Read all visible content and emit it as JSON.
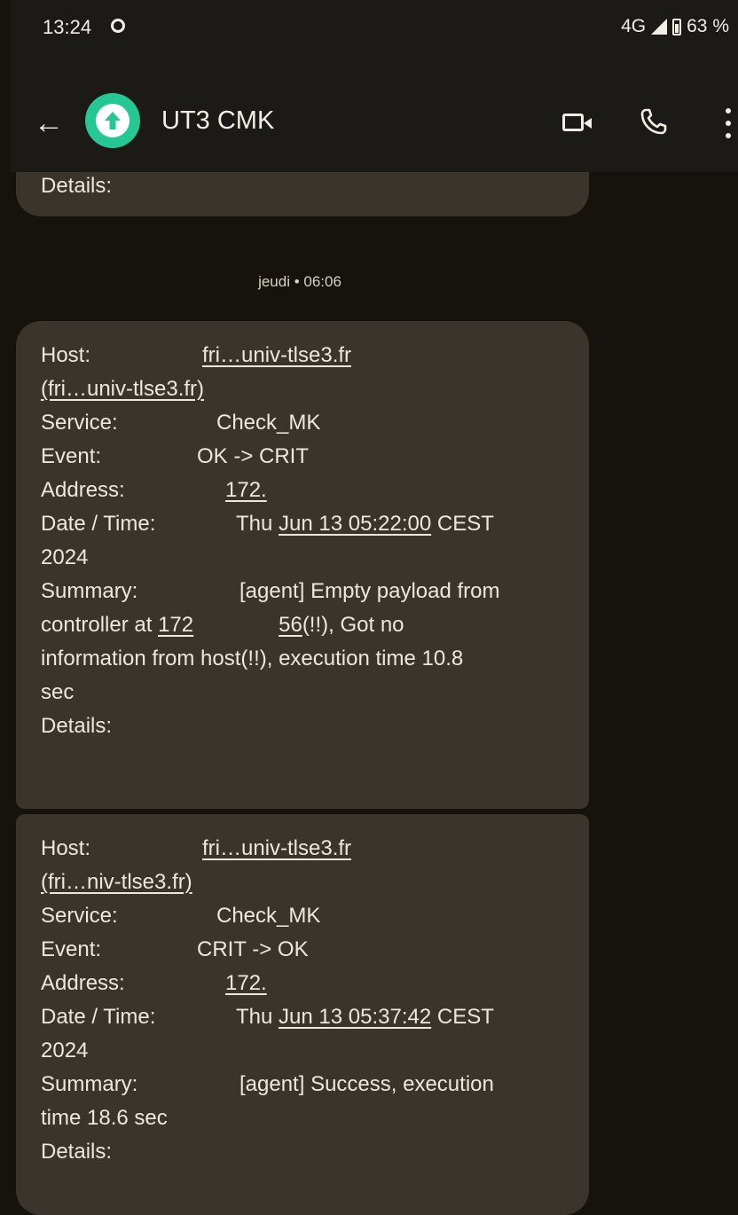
{
  "status_bar": {
    "time": "13:24",
    "network": "4G",
    "battery": "63 %"
  },
  "app_bar": {
    "contact_name": "UT3 CMK",
    "avatar_color": "#25c795"
  },
  "previous_message_tail": "Details:",
  "timestamp": "jeudi • 06:06",
  "messages": [
    {
      "host_label": "Host:",
      "host_value": "fri…univ-tlse3.fr",
      "host_paren": "(fri…univ-tlse3.fr)",
      "service_label": "Service:",
      "service_value": "Check_MK",
      "event_label": "Event:",
      "event_value": "OK -> CRIT",
      "address_label": "Address:",
      "address_value": "172.",
      "datetime_label": "Date / Time:",
      "datetime_prefix": "Thu",
      "datetime_link": "Jun 13 05:22:00",
      "datetime_suffix": "CEST",
      "year": "2024",
      "summary_label": "Summary:",
      "summary_line1": "[agent] Empty payload from",
      "summary_line2_pre": "controller at",
      "summary_line2_link": "172",
      "summary_line2_link2": "56",
      "summary_line2_post": "(!!), Got no",
      "summary_line3": "information from host(!!), execution time 10.8",
      "summary_line4": "sec",
      "details_label": "Details:"
    },
    {
      "host_label": "Host:",
      "host_value": "fri…univ-tlse3.fr",
      "host_paren": "(fri…niv-tlse3.fr)",
      "service_label": "Service:",
      "service_value": "Check_MK",
      "event_label": "Event:",
      "event_value": "CRIT -> OK",
      "address_label": "Address:",
      "address_value": "172.",
      "datetime_label": "Date / Time:",
      "datetime_prefix": "Thu",
      "datetime_link": "Jun 13 05:37:42",
      "datetime_suffix": "CEST",
      "year": "2024",
      "summary_label": "Summary:",
      "summary_line1": "[agent] Success, execution",
      "summary_line2": "time 18.6 sec",
      "details_label": "Details:"
    }
  ]
}
